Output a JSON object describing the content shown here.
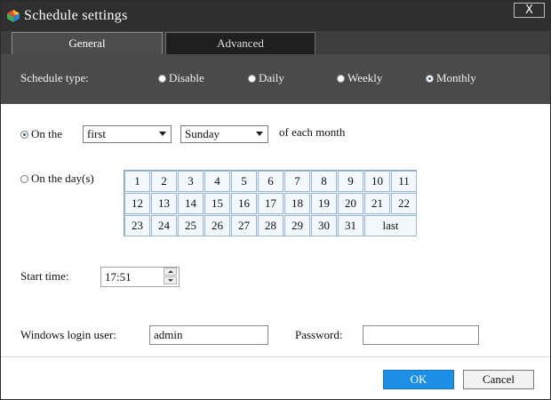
{
  "window": {
    "title": "Schedule settings",
    "close_label": "X"
  },
  "tabs": [
    {
      "label": "General"
    },
    {
      "label": "Advanced"
    }
  ],
  "schedule_type": {
    "label": "Schedule type:",
    "options": [
      {
        "label": "Disable",
        "selected": false
      },
      {
        "label": "Daily",
        "selected": false
      },
      {
        "label": "Weekly",
        "selected": false
      },
      {
        "label": "Monthly",
        "selected": true
      }
    ]
  },
  "monthly": {
    "on_the": {
      "label": "On the",
      "selected": true,
      "ordinal_value": "first",
      "weekday_value": "Sunday",
      "suffix": "of each month"
    },
    "on_days": {
      "label": "On the day(s)",
      "selected": false,
      "days": [
        "1",
        "2",
        "3",
        "4",
        "5",
        "6",
        "7",
        "8",
        "9",
        "10",
        "11",
        "12",
        "13",
        "14",
        "15",
        "16",
        "17",
        "18",
        "19",
        "20",
        "21",
        "22",
        "23",
        "24",
        "25",
        "26",
        "27",
        "28",
        "29",
        "30",
        "31",
        "last"
      ]
    }
  },
  "start_time": {
    "label": "Start time:",
    "value": "17:51"
  },
  "login": {
    "user_label": "Windows login user:",
    "user_value": "admin",
    "password_label": "Password:",
    "password_value": ""
  },
  "buttons": {
    "ok": "OK",
    "cancel": "Cancel"
  },
  "colors": {
    "titlebar": "#2f2f2f",
    "typebar": "#4a4a4a",
    "accent": "#1e8fe6"
  }
}
